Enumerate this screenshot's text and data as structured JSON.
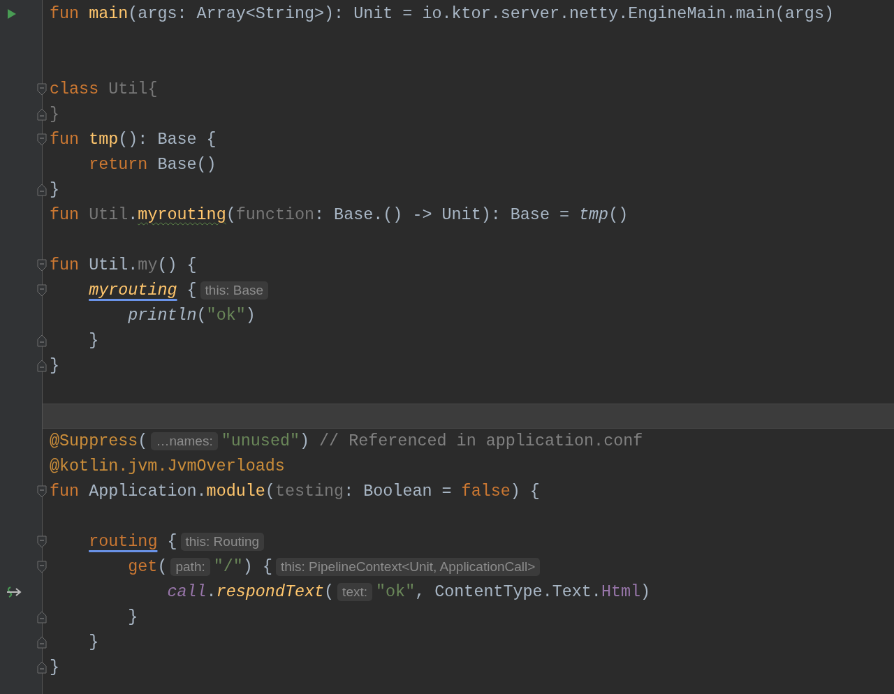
{
  "editor": {
    "lines": [
      {
        "current": false,
        "gutter": {
          "kind": "run"
        },
        "tokens": [
          {
            "t": "fun ",
            "kind": "kw"
          },
          {
            "t": "main",
            "kind": "fn"
          },
          {
            "t": "(args: Array<String>): Unit = io.ktor.server.netty.EngineMain.main(args)",
            "kind": "plain"
          }
        ]
      },
      {
        "current": false
      },
      {
        "current": false
      },
      {
        "current": false,
        "fold": {
          "kind": "open"
        },
        "tokens": [
          {
            "t": "class ",
            "kind": "kw"
          },
          {
            "t": "Util{",
            "kind": "unused"
          }
        ]
      },
      {
        "current": false,
        "fold": {
          "kind": "close"
        },
        "tokens": [
          {
            "t": "}",
            "kind": "unused"
          }
        ]
      },
      {
        "current": false,
        "fold": {
          "kind": "open"
        },
        "tokens": [
          {
            "t": "fun ",
            "kind": "kw"
          },
          {
            "t": "tmp",
            "kind": "fn"
          },
          {
            "t": "(): Base {",
            "kind": "plain"
          }
        ]
      },
      {
        "current": false,
        "tokens": [
          {
            "t": "    return ",
            "kind": "kw"
          },
          {
            "t": "Base()",
            "kind": "plain"
          }
        ]
      },
      {
        "current": false,
        "fold": {
          "kind": "close"
        },
        "tokens": [
          {
            "t": "}",
            "kind": "plain"
          }
        ]
      },
      {
        "current": false,
        "tokens": [
          {
            "t": "fun ",
            "kind": "kw"
          },
          {
            "t": "Util",
            "kind": "unused"
          },
          {
            "t": ".",
            "kind": "plain"
          },
          {
            "t": "myrouting",
            "kind": "fn",
            "decoration": {
              "kind": "typo"
            }
          },
          {
            "t": "(",
            "kind": "plain"
          },
          {
            "t": "function",
            "kind": "unused"
          },
          {
            "t": ": Base.() -> Unit): Base = ",
            "kind": "plain"
          },
          {
            "t": "tmp",
            "kind": "top-fn"
          },
          {
            "t": "()",
            "kind": "plain"
          }
        ]
      },
      {
        "current": false
      },
      {
        "current": false,
        "fold": {
          "kind": "open"
        },
        "tokens": [
          {
            "t": "fun ",
            "kind": "kw"
          },
          {
            "t": "Util.",
            "kind": "plain"
          },
          {
            "t": "my",
            "kind": "unused"
          },
          {
            "t": "() {",
            "kind": "plain"
          }
        ]
      },
      {
        "current": false,
        "fold": {
          "kind": "open"
        },
        "tokens": [
          {
            "t": "    myrouting",
            "kind": "ext-fn",
            "decoration": {
              "kind": "lambda"
            }
          },
          {
            "t": " {",
            "kind": "plain"
          },
          {
            "t": "this: Base",
            "kind": "hint"
          }
        ]
      },
      {
        "current": false,
        "tokens": [
          {
            "t": "        println",
            "kind": "top-fn"
          },
          {
            "t": "(",
            "kind": "plain"
          },
          {
            "t": "\"ok\"",
            "kind": "str"
          },
          {
            "t": ")",
            "kind": "plain"
          }
        ]
      },
      {
        "current": false,
        "fold": {
          "kind": "close"
        },
        "tokens": [
          {
            "t": "    }",
            "kind": "plain"
          }
        ]
      },
      {
        "current": false,
        "fold": {
          "kind": "close"
        },
        "tokens": [
          {
            "t": "}",
            "kind": "plain"
          }
        ]
      },
      {
        "current": false
      },
      {
        "current": true
      },
      {
        "current": false,
        "tokens": [
          {
            "t": "@Suppress",
            "kind": "annot"
          },
          {
            "t": "(",
            "kind": "plain"
          },
          {
            "t": "…names:",
            "kind": "hint"
          },
          {
            "t": "\"unused\"",
            "kind": "str"
          },
          {
            "t": ") ",
            "kind": "plain"
          },
          {
            "t": "// Referenced in application.conf",
            "kind": "comment"
          }
        ]
      },
      {
        "current": false,
        "tokens": [
          {
            "t": "@kotlin.jvm.JvmOverloads",
            "kind": "annot"
          }
        ]
      },
      {
        "current": false,
        "fold": {
          "kind": "open"
        },
        "tokens": [
          {
            "t": "fun ",
            "kind": "kw"
          },
          {
            "t": "Application.",
            "kind": "plain"
          },
          {
            "t": "module",
            "kind": "fn"
          },
          {
            "t": "(",
            "kind": "plain"
          },
          {
            "t": "testing",
            "kind": "unused"
          },
          {
            "t": ": Boolean = ",
            "kind": "plain"
          },
          {
            "t": "false",
            "kind": "kw"
          },
          {
            "t": ") {",
            "kind": "plain"
          }
        ]
      },
      {
        "current": false
      },
      {
        "current": false,
        "fold": {
          "kind": "open"
        },
        "tokens": [
          {
            "t": "    routing",
            "kind": "dsl",
            "decoration": {
              "kind": "lambda"
            }
          },
          {
            "t": " {",
            "kind": "plain"
          },
          {
            "t": "this: Routing",
            "kind": "hint"
          }
        ]
      },
      {
        "current": false,
        "fold": {
          "kind": "open"
        },
        "tokens": [
          {
            "t": "        get",
            "kind": "dsl"
          },
          {
            "t": "(",
            "kind": "plain"
          },
          {
            "t": "path:",
            "kind": "hint"
          },
          {
            "t": "\"/\"",
            "kind": "str"
          },
          {
            "t": ") {",
            "kind": "plain"
          },
          {
            "t": "this: PipelineContext<Unit, ApplicationCall>",
            "kind": "hint"
          }
        ]
      },
      {
        "current": false,
        "gutter": {
          "kind": "lambda"
        },
        "tokens": [
          {
            "t": "            call",
            "kind": "ext-prop"
          },
          {
            "t": ".",
            "kind": "plain"
          },
          {
            "t": "respondText",
            "kind": "ext-fn"
          },
          {
            "t": "(",
            "kind": "plain"
          },
          {
            "t": "text:",
            "kind": "hint"
          },
          {
            "t": "\"ok\"",
            "kind": "str"
          },
          {
            "t": ", ContentType.Text.",
            "kind": "plain"
          },
          {
            "t": "Html",
            "kind": "prop"
          },
          {
            "t": ")",
            "kind": "plain"
          }
        ]
      },
      {
        "current": false,
        "fold": {
          "kind": "close"
        },
        "tokens": [
          {
            "t": "        }",
            "kind": "plain"
          }
        ]
      },
      {
        "current": false,
        "fold": {
          "kind": "close"
        },
        "tokens": [
          {
            "t": "    }",
            "kind": "plain"
          }
        ]
      },
      {
        "current": false,
        "fold": {
          "kind": "close"
        },
        "tokens": [
          {
            "t": "}",
            "kind": "plain"
          }
        ]
      }
    ]
  }
}
